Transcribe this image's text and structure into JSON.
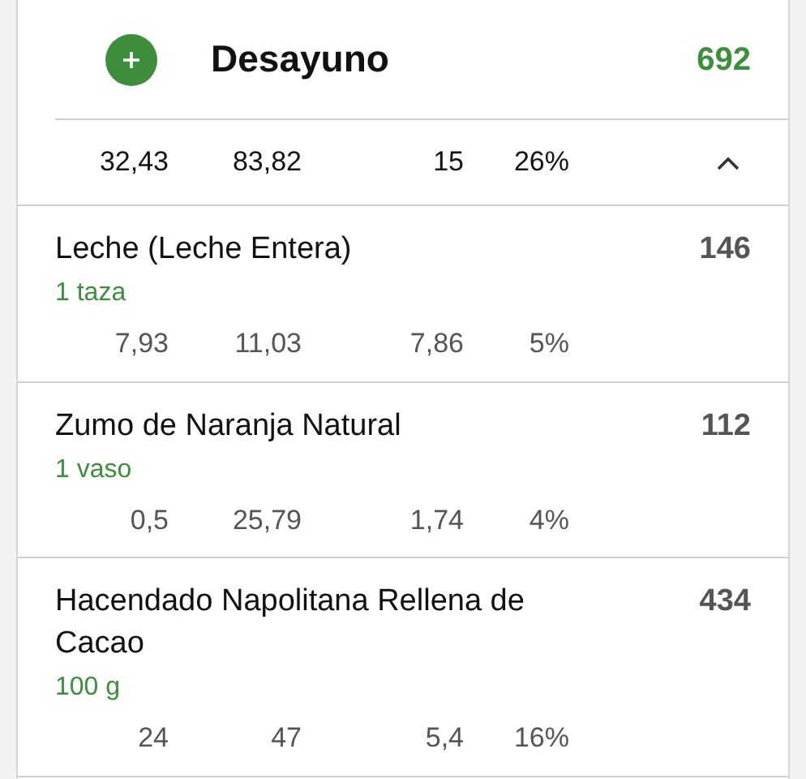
{
  "meal": {
    "title": "Desayuno",
    "calories": "692"
  },
  "summary": {
    "values": [
      "32,43",
      "83,82",
      "15",
      "26%"
    ],
    "expanded": true
  },
  "items": [
    {
      "name": "Leche (Leche Entera)",
      "serving": "1 taza",
      "calories": "146",
      "values": [
        "7,93",
        "11,03",
        "7,86",
        "5%"
      ]
    },
    {
      "name": "Zumo de Naranja Natural",
      "serving": "1 vaso",
      "calories": "112",
      "values": [
        "0,5",
        "25,79",
        "1,74",
        "4%"
      ]
    },
    {
      "name": "Hacendado Napolitana Rellena de Cacao",
      "serving": "100 g",
      "calories": "434",
      "values": [
        "24",
        "47",
        "5,4",
        "16%"
      ]
    }
  ]
}
